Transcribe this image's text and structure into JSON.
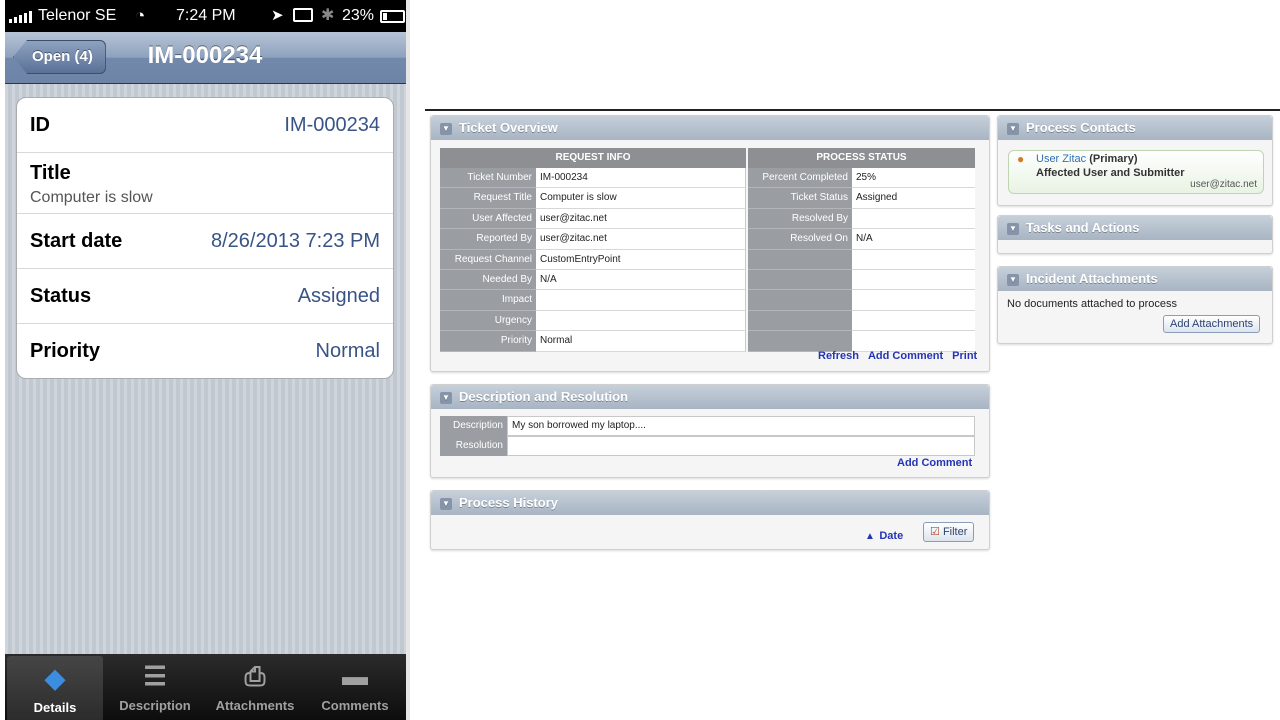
{
  "phone": {
    "status": {
      "carrier": "Telenor SE",
      "time": "7:24 PM",
      "battery": "23%",
      "battery_level": 0.23
    },
    "nav": {
      "back_label": "Open (4)",
      "title": "IM-000234"
    },
    "details": [
      {
        "label": "ID",
        "value": "IM-000234"
      },
      {
        "label": "Title",
        "value": "Computer is slow"
      },
      {
        "label": "Start date",
        "value": "8/26/2013 7:23 PM"
      },
      {
        "label": "Status",
        "value": "Assigned"
      },
      {
        "label": "Priority",
        "value": "Normal"
      }
    ],
    "tabs": [
      {
        "label": "Details",
        "icon": "tag-icon",
        "active": true
      },
      {
        "label": "Description",
        "icon": "notepad-icon",
        "active": false
      },
      {
        "label": "Attachments",
        "icon": "paperclip-icon",
        "active": false
      },
      {
        "label": "Comments",
        "icon": "speech-bubble-icon",
        "active": false
      }
    ]
  },
  "web": {
    "ticket_overview": {
      "title": "Ticket Overview",
      "request_info_header": "REQUEST INFO",
      "process_status_header": "PROCESS STATUS",
      "rows": [
        {
          "k": "Ticket Number",
          "v": "IM-000234",
          "k2": "Percent Completed",
          "v2": "25%"
        },
        {
          "k": "Request Title",
          "v": "Computer is slow",
          "k2": "Ticket Status",
          "v2": "Assigned"
        },
        {
          "k": "User Affected",
          "v": "user@zitac.net",
          "k2": "Resolved By",
          "v2": ""
        },
        {
          "k": "Reported By",
          "v": "user@zitac.net",
          "k2": "Resolved On",
          "v2": "N/A"
        },
        {
          "k": "Request Channel",
          "v": "CustomEntryPoint",
          "k2": "",
          "v2": ""
        },
        {
          "k": "Needed By",
          "v": "N/A",
          "k2": "",
          "v2": ""
        },
        {
          "k": "Impact",
          "v": "",
          "k2": "",
          "v2": ""
        },
        {
          "k": "Urgency",
          "v": "",
          "k2": "",
          "v2": ""
        },
        {
          "k": "Priority",
          "v": "Normal",
          "k2": "",
          "v2": ""
        }
      ],
      "actions": {
        "refresh": "Refresh",
        "add_comment": "Add Comment",
        "print": "Print"
      }
    },
    "description_resolution": {
      "title": "Description and Resolution",
      "description_label": "Description",
      "description_value": "My son borrowed my laptop....",
      "resolution_label": "Resolution",
      "resolution_value": "",
      "add_comment": "Add Comment"
    },
    "process_history": {
      "title": "Process History",
      "date_sort": "Date",
      "filter": "Filter"
    },
    "process_contacts": {
      "title": "Process Contacts",
      "contact_name": "User Zitac",
      "contact_role": "(Primary)",
      "contact_type": "Affected User and Submitter",
      "contact_email": "user@zitac.net"
    },
    "tasks_actions": {
      "title": "Tasks and Actions"
    },
    "incident_attachments": {
      "title": "Incident Attachments",
      "empty_text": "No documents attached to process",
      "add_button": "Add Attachments"
    }
  }
}
